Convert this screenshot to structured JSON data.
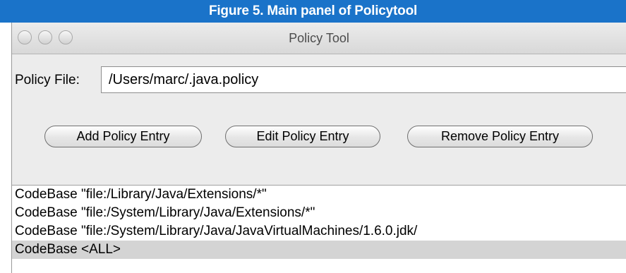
{
  "caption": "Figure 5. Main panel of Policytool",
  "window": {
    "title": "Policy Tool",
    "controls": [
      "close-icon",
      "minimize-icon",
      "zoom-icon"
    ]
  },
  "policy_file": {
    "label": "Policy File:",
    "value": "/Users/marc/.java.policy"
  },
  "buttons": {
    "add": "Add Policy Entry",
    "edit": "Edit Policy Entry",
    "remove": "Remove Policy Entry"
  },
  "entries": [
    "CodeBase \"file:/Library/Java/Extensions/*\"",
    "CodeBase \"file:/System/Library/Java/Extensions/*\"",
    "CodeBase \"file:/System/Library/Java/JavaVirtualMachines/1.6.0.jdk/",
    "CodeBase <ALL>"
  ],
  "selected_entry_index": 3
}
